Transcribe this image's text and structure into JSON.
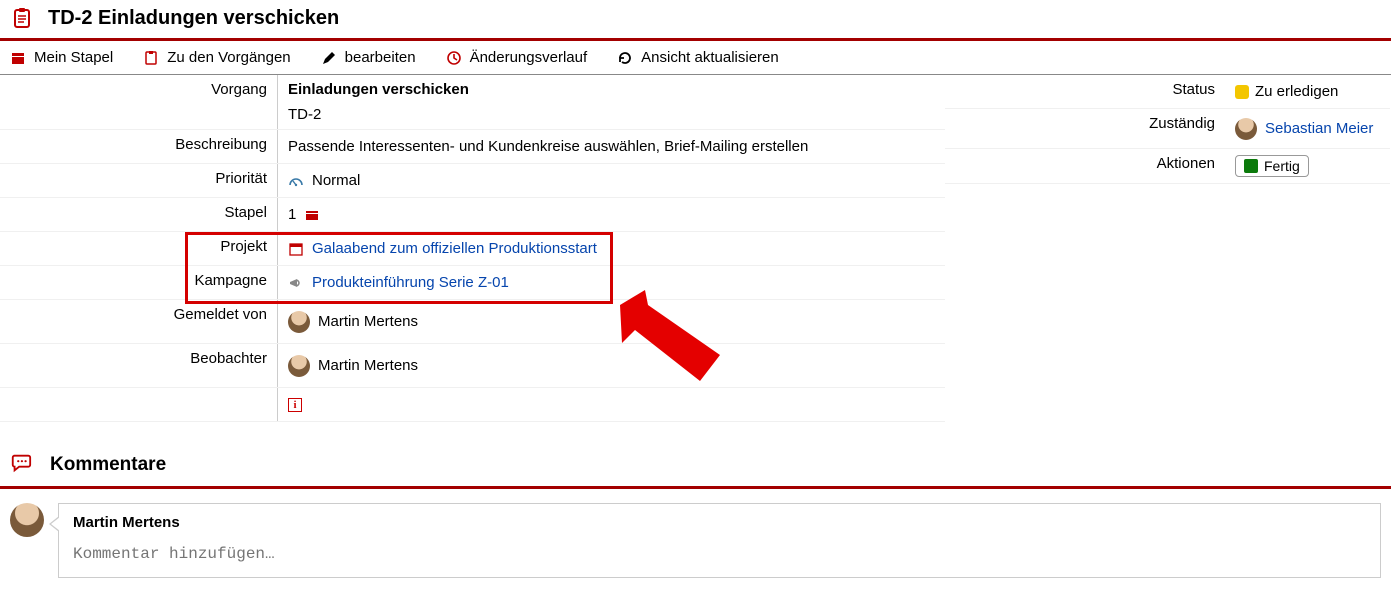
{
  "header": {
    "title": "TD-2 Einladungen verschicken"
  },
  "toolbar": {
    "my_stack": "Mein Stapel",
    "to_tasks": "Zu den Vorgängen",
    "edit": "bearbeiten",
    "history": "Änderungsverlauf",
    "refresh": "Ansicht aktualisieren"
  },
  "fields": {
    "vorgang_label": "Vorgang",
    "vorgang_title": "Einladungen verschicken",
    "vorgang_key": "TD-2",
    "beschreibung_label": "Beschreibung",
    "beschreibung_value": "Passende Interessenten- und Kundenkreise auswählen, Brief-Mailing erstellen",
    "prioritaet_label": "Priorität",
    "prioritaet_value": "Normal",
    "stapel_label": "Stapel",
    "stapel_value": "1",
    "projekt_label": "Projekt",
    "projekt_value": "Galaabend zum offiziellen Produktionsstart",
    "kampagne_label": "Kampagne",
    "kampagne_value": "Produkteinführung Serie Z-01",
    "gemeldet_label": "Gemeldet von",
    "gemeldet_value": "Martin Mertens",
    "beobachter_label": "Beobachter",
    "beobachter_value": "Martin Mertens"
  },
  "side": {
    "status_label": "Status",
    "status_value": "Zu erledigen",
    "zustaendig_label": "Zuständig",
    "zustaendig_value": "Sebastian Meier",
    "aktionen_label": "Aktionen",
    "aktion_fertig": "Fertig"
  },
  "comments": {
    "heading": "Kommentare",
    "author": "Martin Mertens",
    "placeholder": "Kommentar hinzufügen…"
  }
}
